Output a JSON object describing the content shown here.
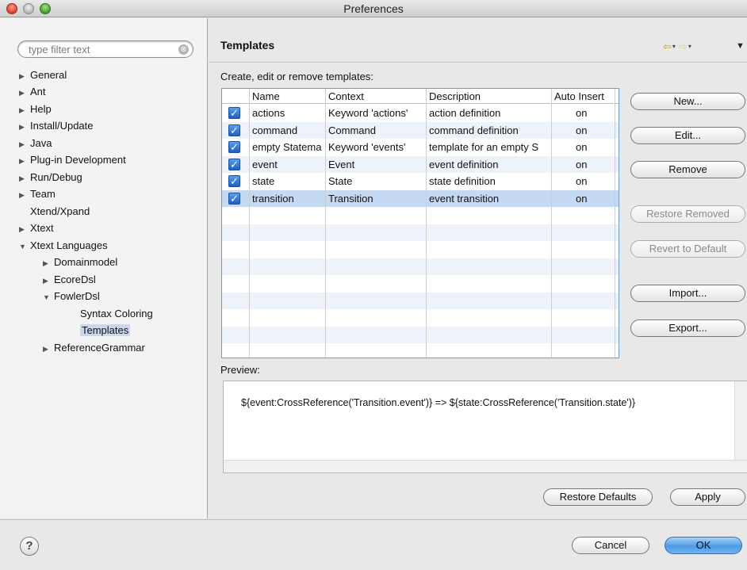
{
  "window": {
    "title": "Preferences"
  },
  "filter": {
    "placeholder": "type filter text",
    "clear_glyph": "⊗"
  },
  "tree": [
    {
      "label": "General",
      "arrow": "▶"
    },
    {
      "label": "Ant",
      "arrow": "▶"
    },
    {
      "label": "Help",
      "arrow": "▶"
    },
    {
      "label": "Install/Update",
      "arrow": "▶"
    },
    {
      "label": "Java",
      "arrow": "▶"
    },
    {
      "label": "Plug-in Development",
      "arrow": "▶"
    },
    {
      "label": "Run/Debug",
      "arrow": "▶"
    },
    {
      "label": "Team",
      "arrow": "▶"
    },
    {
      "label": "Xtend/Xpand",
      "arrow": ""
    },
    {
      "label": "Xtext",
      "arrow": "▶"
    },
    {
      "label": "Xtext Languages",
      "arrow": "▼"
    },
    {
      "label": "Domainmodel",
      "arrow": "▶"
    },
    {
      "label": "EcoreDsl",
      "arrow": "▶"
    },
    {
      "label": "FowlerDsl",
      "arrow": "▼"
    },
    {
      "label": "Syntax Coloring",
      "arrow": ""
    },
    {
      "label": "Templates",
      "arrow": "",
      "selected": true
    },
    {
      "label": "ReferenceGrammar",
      "arrow": "▶"
    }
  ],
  "page": {
    "title": "Templates",
    "intro": "Create, edit or remove templates:",
    "nav": {
      "back": "⇦",
      "forward": "⇨",
      "dropdown": "▾",
      "menu": "▼"
    }
  },
  "table": {
    "headers": [
      "Name",
      "Context",
      "Description",
      "Auto Insert"
    ],
    "rows": [
      {
        "checked": true,
        "name": "actions",
        "context": "Keyword 'actions'",
        "description": "action definition",
        "auto": "on"
      },
      {
        "checked": true,
        "name": "command",
        "context": "Command",
        "description": "command definition",
        "auto": "on"
      },
      {
        "checked": true,
        "name": "empty Statema",
        "context": "Keyword 'events'",
        "description": "template for an empty S",
        "auto": "on"
      },
      {
        "checked": true,
        "name": "event",
        "context": "Event",
        "description": "event definition",
        "auto": "on"
      },
      {
        "checked": true,
        "name": "state",
        "context": "State",
        "description": "state definition",
        "auto": "on"
      },
      {
        "checked": true,
        "name": "transition",
        "context": "Transition",
        "description": "event transition",
        "auto": "on",
        "selected": true
      }
    ],
    "check_glyph": "✓"
  },
  "buttons": {
    "new": "New...",
    "edit": "Edit...",
    "remove": "Remove",
    "restore_removed": "Restore Removed",
    "revert_default": "Revert to Default",
    "import": "Import...",
    "export": "Export...",
    "restore_defaults": "Restore Defaults",
    "apply": "Apply",
    "cancel": "Cancel",
    "ok": "OK"
  },
  "preview": {
    "label": "Preview:",
    "text": "${event:CrossReference('Transition.event')} => ${state:CrossReference('Transition.state')}"
  },
  "help": {
    "glyph": "?"
  }
}
